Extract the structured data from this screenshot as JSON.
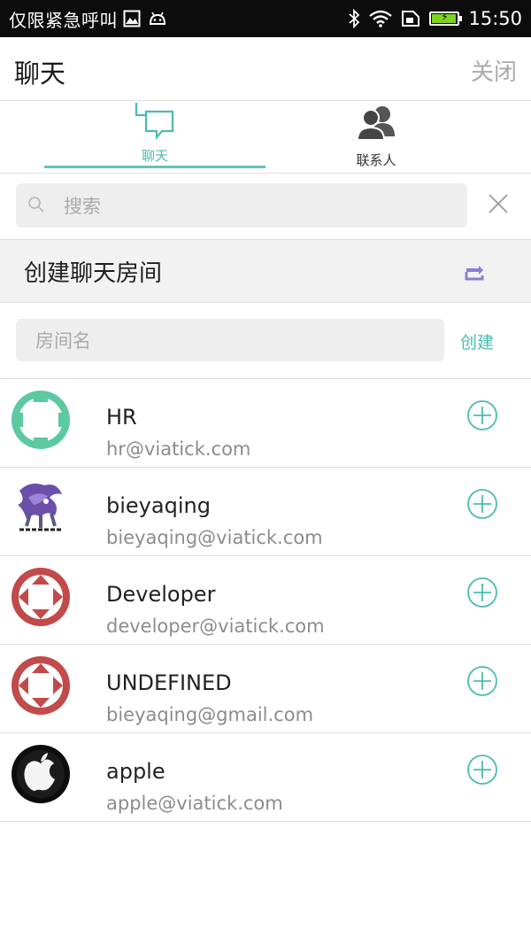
{
  "status_bar": {
    "carrier": "仅限紧急呼叫",
    "time": "15:50",
    "battery_level": 0.95,
    "icons": [
      "image-icon",
      "android-icon",
      "bluetooth-icon",
      "wifi-icon",
      "sim-icon",
      "battery-icon"
    ]
  },
  "header": {
    "title": "聊天",
    "close_label": "关闭"
  },
  "tabs": [
    {
      "label": "聊天",
      "icon": "chat-bubbles-icon",
      "active": true
    },
    {
      "label": "联系人",
      "icon": "contacts-icon",
      "active": false
    }
  ],
  "search": {
    "placeholder": "搜索",
    "value": ""
  },
  "create_room": {
    "title": "创建聊天房间",
    "room_name_placeholder": "房间名",
    "room_name_value": "",
    "create_label": "创建"
  },
  "contacts": [
    {
      "name": "HR",
      "email": "hr@viatick.com",
      "avatar": "green-ring"
    },
    {
      "name": "bieyaqing",
      "email": "bieyaqing@viatick.com",
      "avatar": "suicune-image"
    },
    {
      "name": "Developer",
      "email": "developer@viatick.com",
      "avatar": "red-ring"
    },
    {
      "name": "UNDEFINED",
      "email": "bieyaqing@gmail.com",
      "avatar": "red-ring"
    },
    {
      "name": "apple",
      "email": "apple@viatick.com",
      "avatar": "apple-logo"
    }
  ],
  "colors": {
    "accent": "#4bbcb0",
    "accent_line": "#62c3b8",
    "swap_icon": "#8a7fd4",
    "avatar_green": "#5cc9a0",
    "avatar_red": "#c14a4a",
    "status_bar_bg": "#0c0c0c"
  }
}
